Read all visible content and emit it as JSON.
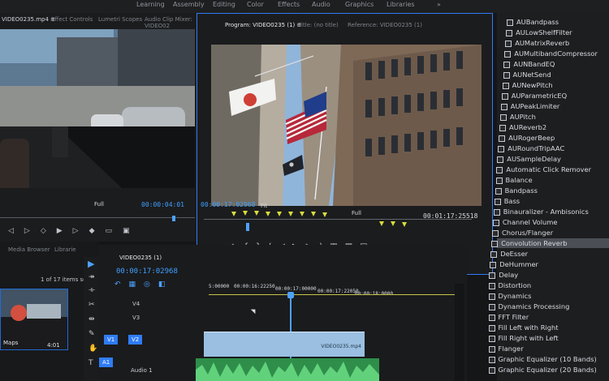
{
  "workspaces": [
    "Learning",
    "Assembly",
    "Editing",
    "Color",
    "Effects",
    "Audio",
    "Graphics",
    "Libraries",
    "»"
  ],
  "left_tabs": [
    "VIDEO0235.mp4 ≡",
    "Effect Controls",
    "Lumetri Scopes",
    "Audio Clip Mixer: VIDEO02"
  ],
  "source": {
    "fit": "Full",
    "timecode": "00:00:04:01"
  },
  "program": {
    "tab_program": "Program: VIDEO0235 (1) ≡",
    "tab_title": "Title: (no title)",
    "tab_reference": "Reference: VIDEO0235 (1)",
    "timecode": "00:00:17:02968",
    "fit": "Fit",
    "quality": "Full",
    "duration": "00:01:17:25518"
  },
  "bottom_left": {
    "tabs": [
      "Media Browser",
      "Librarie"
    ],
    "count_label": "1 of 17 items sele...",
    "clip_label": "Maps",
    "clip_duration": "4:01"
  },
  "timeline": {
    "tab": "VIDEO0235 (1)",
    "timecode": "00:00:17:02968",
    "ruler": [
      "5:00000",
      "00:00:16:22250",
      "00:00:17:00000",
      "00:00:17:22050",
      "00:00:18:0000"
    ],
    "tracks": [
      "V4",
      "V3",
      "V2",
      "V1",
      "A1",
      "Audio 1"
    ],
    "clip_label": "VIDEO0235.mp4"
  },
  "effects": [
    "AUBandpass",
    "AULowShelfFilter",
    "AUMatrixReverb",
    "AUMultibandCompressor",
    "AUNBandEQ",
    "AUNetSend",
    "AUNewPitch",
    "AUParametricEQ",
    "AUPeakLimiter",
    "AUPitch",
    "AUReverb2",
    "AURogerBeep",
    "AURoundTripAAC",
    "AUSampleDelay",
    "Automatic Click Remover",
    "Balance",
    "Bandpass",
    "Bass",
    "Binauralizer - Ambisonics",
    "Channel Volume",
    "Chorus/Flanger",
    "Convolution Reverb",
    "DeEsser",
    "DeHummer",
    "Delay",
    "Distortion",
    "Dynamics",
    "Dynamics Processing",
    "FFT Filter",
    "Fill Left with Right",
    "Fill Right with Left",
    "Flanger",
    "Graphic Equalizer (10 Bands)",
    "Graphic Equalizer (20 Bands)"
  ],
  "selected_effect": "Convolution Reverb",
  "colors": {
    "accent": "#2f7cf6",
    "timecode": "#3fa0ff",
    "audio": "#4fbf63",
    "video_clip": "#8eb7dd"
  }
}
